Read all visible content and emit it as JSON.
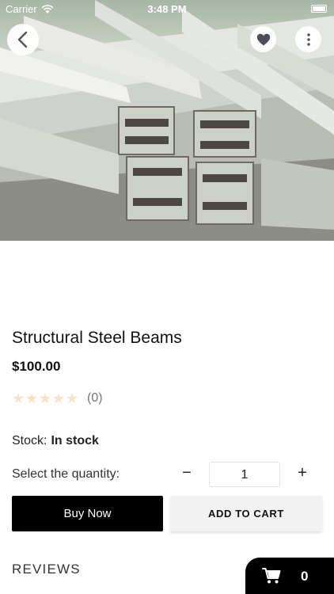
{
  "status_bar": {
    "carrier": "Carrier",
    "time": "3:48 PM"
  },
  "product": {
    "title": "Structural Steel Beams",
    "price": "$100.00",
    "rating_stars": 0,
    "rating_count": "(0)",
    "stock_label": "Stock:",
    "stock_value": "In stock",
    "quantity_label": "Select the quantity:",
    "quantity_value": "1",
    "decrement_symbol": "−",
    "increment_symbol": "+"
  },
  "actions": {
    "buy_now": "Buy Now",
    "add_to_cart": "ADD TO CART"
  },
  "sections": {
    "reviews": "REVIEWS"
  },
  "cart": {
    "count": "0"
  },
  "icons": {
    "back": "chevron-left-icon",
    "favorite": "heart-icon",
    "more": "more-vertical-icon",
    "cart": "shopping-cart-icon"
  },
  "colors": {
    "accent": "#000000",
    "secondary_button": "#f2f2f3",
    "star_empty": "#f6e3c5"
  }
}
